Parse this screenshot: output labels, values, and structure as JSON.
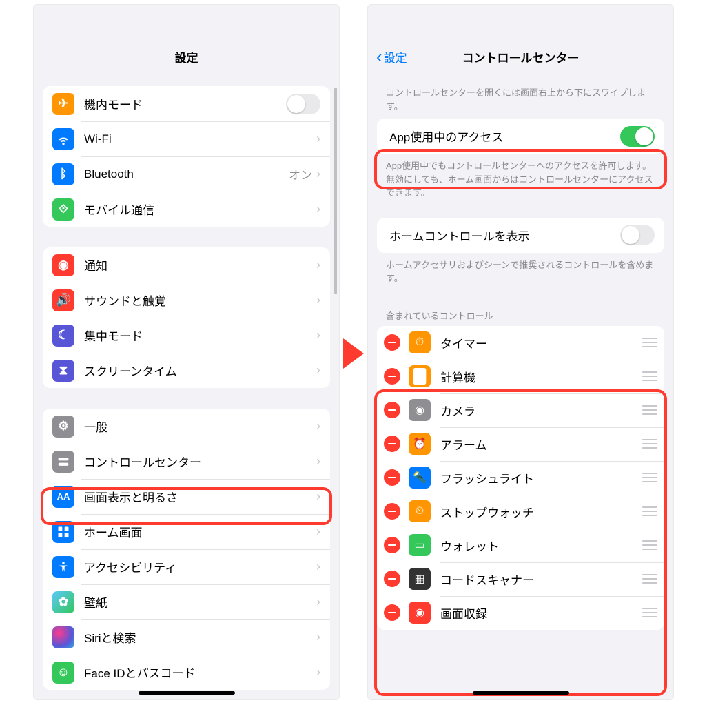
{
  "left": {
    "title": "設定",
    "groups": [
      [
        {
          "key": "airplane",
          "icon": "airplane-icon",
          "label": "機内モード",
          "toggle": false,
          "color": "ic-orange"
        },
        {
          "key": "wifi",
          "icon": "wifi-icon",
          "label": "Wi-Fi",
          "chevron": true,
          "color": "ic-blue"
        },
        {
          "key": "bluetooth",
          "icon": "bluetooth-icon",
          "label": "Bluetooth",
          "value": "オン",
          "chevron": true,
          "color": "ic-blue"
        },
        {
          "key": "cellular",
          "icon": "antenna-icon",
          "label": "モバイル通信",
          "chevron": true,
          "color": "ic-green"
        }
      ],
      [
        {
          "key": "notifications",
          "icon": "bell-icon",
          "label": "通知",
          "chevron": true,
          "color": "ic-red"
        },
        {
          "key": "sound",
          "icon": "speaker-icon",
          "label": "サウンドと触覚",
          "chevron": true,
          "color": "ic-red"
        },
        {
          "key": "focus",
          "icon": "moon-icon",
          "label": "集中モード",
          "chevron": true,
          "color": "ic-purple"
        },
        {
          "key": "screentime",
          "icon": "hourglass-icon",
          "label": "スクリーンタイム",
          "chevron": true,
          "color": "ic-purple"
        }
      ],
      [
        {
          "key": "general",
          "icon": "gear-icon",
          "label": "一般",
          "chevron": true,
          "color": "ic-gray"
        },
        {
          "key": "controlcenter",
          "icon": "switches-icon",
          "label": "コントロールセンター",
          "chevron": true,
          "color": "ic-gray",
          "highlighted": true
        },
        {
          "key": "display",
          "icon": "aa-icon",
          "label": "画面表示と明るさ",
          "chevron": true,
          "color": "ic-blue"
        },
        {
          "key": "home",
          "icon": "grid-icon",
          "label": "ホーム画面",
          "chevron": true,
          "color": "ic-blue"
        },
        {
          "key": "accessibility",
          "icon": "person-icon",
          "label": "アクセシビリティ",
          "chevron": true,
          "color": "ic-blue"
        },
        {
          "key": "wallpaper",
          "icon": "flower-icon",
          "label": "壁紙",
          "chevron": true,
          "color": "wallpaper-icon"
        },
        {
          "key": "siri",
          "icon": "siri-icon",
          "label": "Siriと検索",
          "chevron": true,
          "color": "siri-icon"
        },
        {
          "key": "faceid",
          "icon": "faceid-icon",
          "label": "Face IDとパスコード",
          "chevron": true,
          "color": "ic-green"
        }
      ]
    ]
  },
  "right": {
    "back_label": "設定",
    "title": "コントロールセンター",
    "caption1": "コントロールセンターを開くには画面右上から下にスワイプします。",
    "access_label": "App使用中のアクセス",
    "access_on": true,
    "caption2": "App使用中でもコントロールセンターへのアクセスを許可します。無効にしても、ホーム画面からはコントロールセンターにアクセスできます。",
    "home_label": "ホームコントロールを表示",
    "home_on": false,
    "caption3": "ホームアクセサリおよびシーンで推奨されるコントロールを含めます。",
    "section_title": "含まれているコントロール",
    "controls": [
      {
        "key": "timer",
        "icon": "timer-icon",
        "label": "タイマー",
        "color": "c-orange"
      },
      {
        "key": "calculator",
        "icon": "calculator-icon",
        "label": "計算機",
        "color": "c-orange"
      },
      {
        "key": "camera",
        "icon": "camera-icon",
        "label": "カメラ",
        "color": "c-gray"
      },
      {
        "key": "alarm",
        "icon": "alarm-icon",
        "label": "アラーム",
        "color": "c-orange"
      },
      {
        "key": "flashlight",
        "icon": "flashlight-icon",
        "label": "フラッシュライト",
        "color": "c-blue"
      },
      {
        "key": "stopwatch",
        "icon": "stopwatch-icon",
        "label": "ストップウォッチ",
        "color": "c-orange"
      },
      {
        "key": "wallet",
        "icon": "wallet-icon",
        "label": "ウォレット",
        "color": "c-green"
      },
      {
        "key": "codescan",
        "icon": "qr-icon",
        "label": "コードスキャナー",
        "color": "c-dark"
      },
      {
        "key": "screenrec",
        "icon": "record-icon",
        "label": "画面収録",
        "color": "c-red"
      }
    ]
  }
}
